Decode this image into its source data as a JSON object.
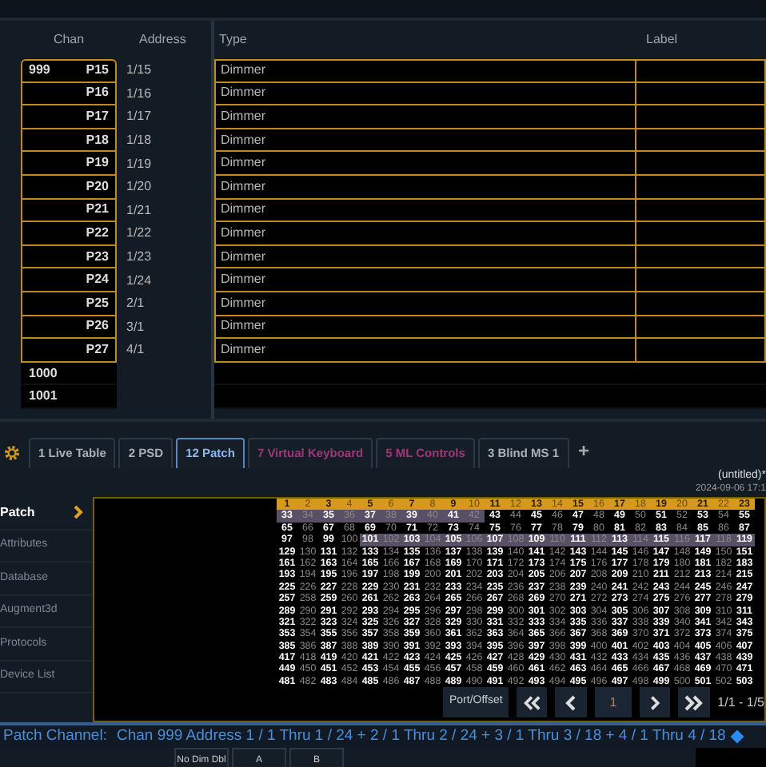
{
  "patch_table": {
    "columns": [
      "Chan",
      "Address",
      "Type",
      "Label"
    ],
    "rows": [
      {
        "chan": "999",
        "part": "P15",
        "address": "1/15",
        "type": "Dimmer",
        "selected": true
      },
      {
        "part": "P16",
        "address": "1/16",
        "type": "Dimmer",
        "selected": true
      },
      {
        "part": "P17",
        "address": "1/17",
        "type": "Dimmer",
        "selected": true
      },
      {
        "part": "P18",
        "address": "1/18",
        "type": "Dimmer",
        "selected": true
      },
      {
        "part": "P19",
        "address": "1/19",
        "type": "Dimmer",
        "selected": true
      },
      {
        "part": "P20",
        "address": "1/20",
        "type": "Dimmer",
        "selected": true
      },
      {
        "part": "P21",
        "address": "1/21",
        "type": "Dimmer",
        "selected": true
      },
      {
        "part": "P22",
        "address": "1/22",
        "type": "Dimmer",
        "selected": true
      },
      {
        "part": "P23",
        "address": "1/23",
        "type": "Dimmer",
        "selected": true
      },
      {
        "part": "P24",
        "address": "1/24",
        "type": "Dimmer",
        "selected": true
      },
      {
        "part": "P25",
        "address": "2/1",
        "type": "Dimmer",
        "selected": true
      },
      {
        "part": "P26",
        "address": "3/1",
        "type": "Dimmer",
        "selected": true
      },
      {
        "part": "P27",
        "address": "4/1",
        "type": "Dimmer",
        "selected": true
      },
      {
        "chan": "1000",
        "selected": false
      },
      {
        "chan": "1001",
        "selected": false
      }
    ]
  },
  "tabs": [
    {
      "label": "1 Live Table",
      "kind": "tab",
      "selected": false
    },
    {
      "label": "2 PSD",
      "kind": "tab",
      "selected": false
    },
    {
      "label": "12 Patch",
      "kind": "tab",
      "selected": true
    },
    {
      "label": "7 Virtual Keyboard",
      "kind": "tool",
      "selected": false
    },
    {
      "label": "5 ML Controls",
      "kind": "tool",
      "selected": false
    },
    {
      "label": "3 Blind MS 1",
      "kind": "tab",
      "selected": false
    }
  ],
  "add_tab": "+",
  "show_file": {
    "name": "(untitled)*",
    "date": "2024-09-06 17:1"
  },
  "side_menu": [
    {
      "label": "Patch",
      "selected": true
    },
    {
      "label": "Attributes",
      "selected": false
    },
    {
      "label": "Database",
      "selected": false
    },
    {
      "label": "Augment3d",
      "selected": false
    },
    {
      "label": "Protocols",
      "selected": false
    },
    {
      "label": "Device List",
      "selected": false
    }
  ],
  "address_grid": {
    "rows": [
      {
        "selected": true,
        "values": [
          "1",
          "2",
          "3",
          "4",
          "5",
          "6",
          "7",
          "8",
          "9",
          "10",
          "11",
          "12",
          "13",
          "14",
          "15",
          "16",
          "17",
          "18",
          "19",
          "20",
          "21",
          "22",
          "23"
        ]
      },
      {
        "selected": false,
        "values": [
          "33",
          "34",
          "35",
          "36",
          "37",
          "38",
          "39",
          "40",
          "41",
          "42",
          "43",
          "44",
          "45",
          "46",
          "47",
          "48",
          "49",
          "50",
          "51",
          "52",
          "53",
          "54",
          "55"
        ],
        "highlighted": [
          true,
          true,
          true,
          true,
          true,
          true,
          true,
          true,
          true,
          true,
          false,
          false,
          false,
          false,
          false,
          false,
          false,
          false,
          false,
          false,
          false,
          false,
          false
        ]
      },
      {
        "selected": false,
        "values": [
          "65",
          "66",
          "67",
          "68",
          "69",
          "70",
          "71",
          "72",
          "73",
          "74",
          "75",
          "76",
          "77",
          "78",
          "79",
          "80",
          "81",
          "82",
          "83",
          "84",
          "85",
          "86",
          "87"
        ]
      },
      {
        "selected": false,
        "values": [
          "97",
          "98",
          "99",
          "100",
          "101",
          "102",
          "103",
          "104",
          "105",
          "106",
          "107",
          "108",
          "109",
          "110",
          "111",
          "112",
          "113",
          "114",
          "115",
          "116",
          "117",
          "118",
          "119"
        ],
        "highlighted": [
          false,
          false,
          false,
          false,
          true,
          true,
          true,
          true,
          true,
          true,
          true,
          true,
          true,
          true,
          true,
          true,
          true,
          true,
          true,
          true,
          true,
          true,
          true
        ]
      },
      {
        "selected": false,
        "values": [
          "129",
          "130",
          "131",
          "132",
          "133",
          "134",
          "135",
          "136",
          "137",
          "138",
          "139",
          "140",
          "141",
          "142",
          "143",
          "144",
          "145",
          "146",
          "147",
          "148",
          "149",
          "150",
          "151"
        ]
      },
      {
        "selected": false,
        "values": [
          "161",
          "162",
          "163",
          "164",
          "165",
          "166",
          "167",
          "168",
          "169",
          "170",
          "171",
          "172",
          "173",
          "174",
          "175",
          "176",
          "177",
          "178",
          "179",
          "180",
          "181",
          "182",
          "183"
        ]
      },
      {
        "selected": false,
        "values": [
          "193",
          "194",
          "195",
          "196",
          "197",
          "198",
          "199",
          "200",
          "201",
          "202",
          "203",
          "204",
          "205",
          "206",
          "207",
          "208",
          "209",
          "210",
          "211",
          "212",
          "213",
          "214",
          "215"
        ]
      },
      {
        "selected": false,
        "values": [
          "225",
          "226",
          "227",
          "228",
          "229",
          "230",
          "231",
          "232",
          "233",
          "234",
          "235",
          "236",
          "237",
          "238",
          "239",
          "240",
          "241",
          "242",
          "243",
          "244",
          "245",
          "246",
          "247"
        ]
      },
      {
        "selected": false,
        "values": [
          "257",
          "258",
          "259",
          "260",
          "261",
          "262",
          "263",
          "264",
          "265",
          "266",
          "267",
          "268",
          "269",
          "270",
          "271",
          "272",
          "273",
          "274",
          "275",
          "276",
          "277",
          "278",
          "279"
        ]
      },
      {
        "selected": false,
        "values": [
          "289",
          "290",
          "291",
          "292",
          "293",
          "294",
          "295",
          "296",
          "297",
          "298",
          "299",
          "300",
          "301",
          "302",
          "303",
          "304",
          "305",
          "306",
          "307",
          "308",
          "309",
          "310",
          "311"
        ]
      },
      {
        "selected": false,
        "values": [
          "321",
          "322",
          "323",
          "324",
          "325",
          "326",
          "327",
          "328",
          "329",
          "330",
          "331",
          "332",
          "333",
          "334",
          "335",
          "336",
          "337",
          "338",
          "339",
          "340",
          "341",
          "342",
          "343"
        ]
      },
      {
        "selected": false,
        "values": [
          "353",
          "354",
          "355",
          "356",
          "357",
          "358",
          "359",
          "360",
          "361",
          "362",
          "363",
          "364",
          "365",
          "366",
          "367",
          "368",
          "369",
          "370",
          "371",
          "372",
          "373",
          "374",
          "375"
        ]
      },
      {
        "selected": false,
        "values": [
          "385",
          "386",
          "387",
          "388",
          "389",
          "390",
          "391",
          "392",
          "393",
          "394",
          "395",
          "396",
          "397",
          "398",
          "399",
          "400",
          "401",
          "402",
          "403",
          "404",
          "405",
          "406",
          "407"
        ]
      },
      {
        "selected": false,
        "values": [
          "417",
          "418",
          "419",
          "420",
          "421",
          "422",
          "423",
          "424",
          "425",
          "426",
          "427",
          "428",
          "429",
          "430",
          "431",
          "432",
          "433",
          "434",
          "435",
          "436",
          "437",
          "438",
          "439"
        ]
      },
      {
        "selected": false,
        "values": [
          "449",
          "450",
          "451",
          "452",
          "453",
          "454",
          "455",
          "456",
          "457",
          "458",
          "459",
          "460",
          "461",
          "462",
          "463",
          "464",
          "465",
          "466",
          "467",
          "468",
          "469",
          "470",
          "471"
        ]
      },
      {
        "selected": false,
        "values": [
          "481",
          "482",
          "483",
          "484",
          "485",
          "486",
          "487",
          "488",
          "489",
          "490",
          "491",
          "492",
          "493",
          "494",
          "495",
          "496",
          "497",
          "498",
          "499",
          "500",
          "501",
          "502",
          "503"
        ]
      }
    ]
  },
  "pager": {
    "port_offset": "Port/Offset",
    "page": "1",
    "range": "1/1 - 1/5"
  },
  "command_line": {
    "prompt": "Patch Channel:",
    "text": "Chan 999 Address 1 / 1 Thru 1 / 24 + 2 / 1 Thru 2 / 24 + 3 / 1 Thru 3 / 18 + 4 / 1 Thru 4 / 18"
  },
  "softkeys": [
    "No Dim Dbl",
    "A",
    "B"
  ]
}
